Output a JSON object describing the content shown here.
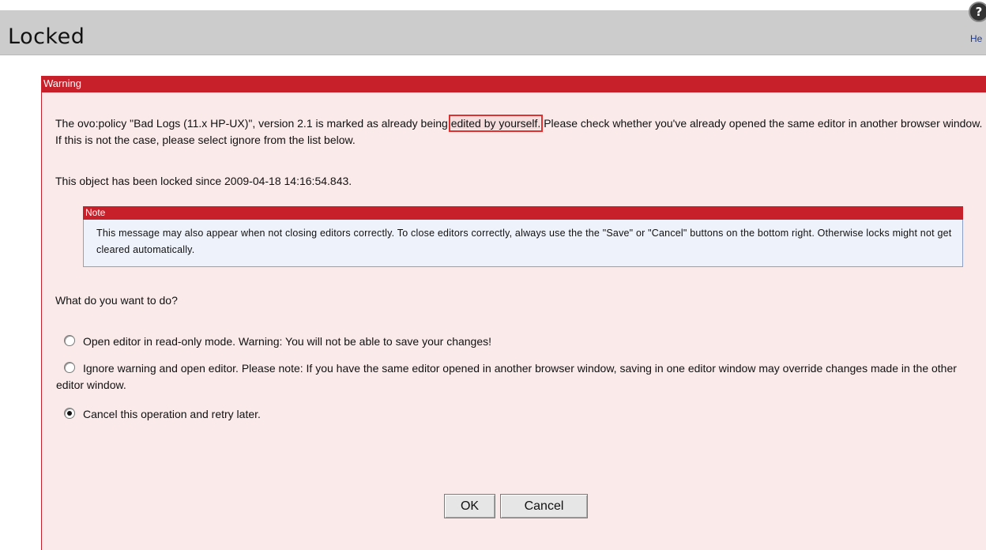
{
  "header": {
    "title": "Locked",
    "help_icon_glyph": "?",
    "help_label": "He"
  },
  "warning": {
    "title": "Warning",
    "message_part1": "The ovo:policy \"Bad Logs (11.x HP-UX)\", version 2.1 is marked as already being ",
    "message_highlight": "edited by yourself.",
    "message_part2": " Please check whether you've already opened the same editor in another browser window. If this is not the case, please select ignore from the list below.",
    "locked_since": "This object has been locked since 2009-04-18 14:16:54.843."
  },
  "note": {
    "title": "Note",
    "text": "This message may also appear when not closing editors correctly. To close editors correctly, always use the the \"Save\" or \"Cancel\" buttons on the bottom right. Otherwise locks might not get cleared automatically."
  },
  "question": "What do you want to do?",
  "options": [
    {
      "label": "Open editor in read-only mode. Warning: You will not be able to save your changes!",
      "selected": false
    },
    {
      "label": "Ignore warning and open editor. Please note: If you have the same editor opened in another browser window, saving in one editor window may override changes made in the other editor window.",
      "selected": false
    },
    {
      "label": "Cancel this operation and retry later.",
      "selected": true
    }
  ],
  "buttons": {
    "ok": "OK",
    "cancel": "Cancel"
  },
  "colors": {
    "warning_red": "#c8202a",
    "panel_bg": "#fbeaea",
    "title_bar_bg": "#cccccc",
    "note_bg": "#eef2fb"
  }
}
